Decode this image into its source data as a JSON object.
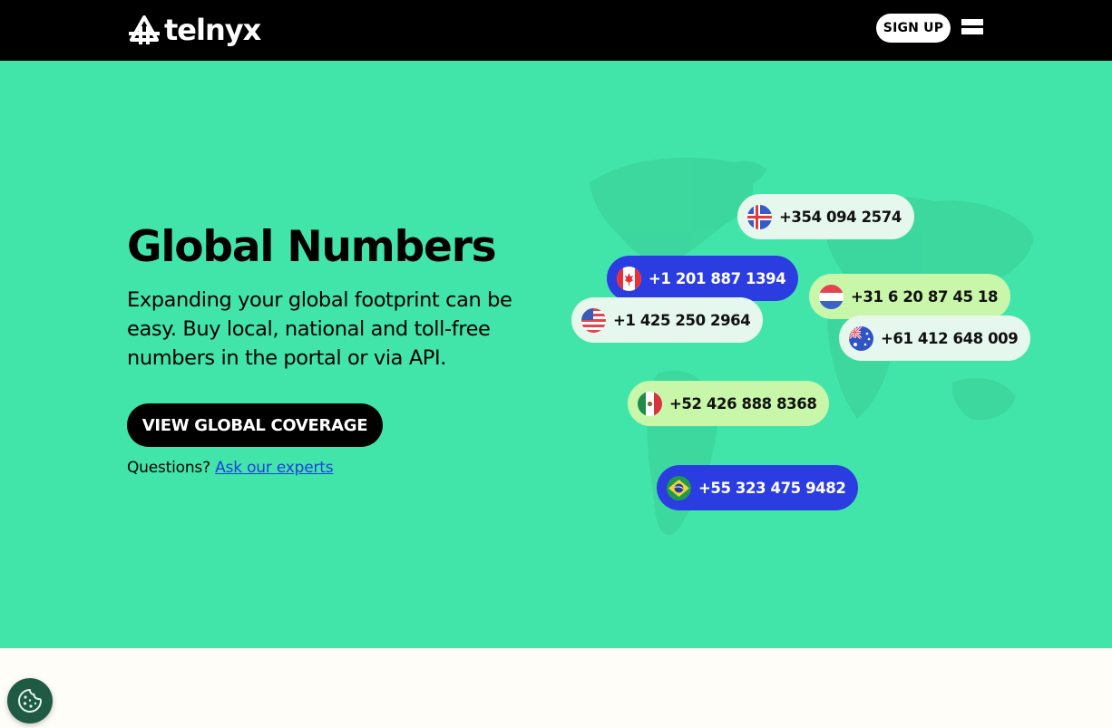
{
  "header": {
    "brand": "telnyx",
    "signup_label": "SIGN UP",
    "menu_icon": "hamburger-icon"
  },
  "hero": {
    "title": "Global Numbers",
    "description": "Expanding your global footprint can be easy. Buy local, national and toll-free numbers in the portal or via API.",
    "cta_label": "VIEW GLOBAL COVERAGE",
    "questions_prefix": "Questions?",
    "questions_link": "Ask our experts",
    "background_color": "#42e5a9"
  },
  "phone_numbers": [
    {
      "country": "Iceland",
      "flag": "iceland-flag-icon",
      "number": "+354 094 2574",
      "style": "light"
    },
    {
      "country": "Canada",
      "flag": "canada-flag-icon",
      "number": "+1 201 887 1394",
      "style": "blue"
    },
    {
      "country": "Netherlands",
      "flag": "netherlands-flag-icon",
      "number": "+31 6 20 87 45 18",
      "style": "lime"
    },
    {
      "country": "United States",
      "flag": "usa-flag-icon",
      "number": "+1 425 250 2964",
      "style": "light"
    },
    {
      "country": "Australia",
      "flag": "australia-flag-icon",
      "number": "+61 412 648 009",
      "style": "light"
    },
    {
      "country": "Mexico",
      "flag": "mexico-flag-icon",
      "number": "+52 426 888 8368",
      "style": "lime"
    },
    {
      "country": "Brazil",
      "flag": "brazil-flag-icon",
      "number": "+55 323 475 9482",
      "style": "blue"
    }
  ],
  "colors": {
    "header_bg": "#000000",
    "pill_blue": "#2b3de0",
    "pill_lime": "#c9f7a9",
    "pill_light": "#e6f8ee",
    "link": "#1d3fd9",
    "cookie_button": "#1f5a44"
  },
  "cookie_button_icon": "cookie-icon"
}
